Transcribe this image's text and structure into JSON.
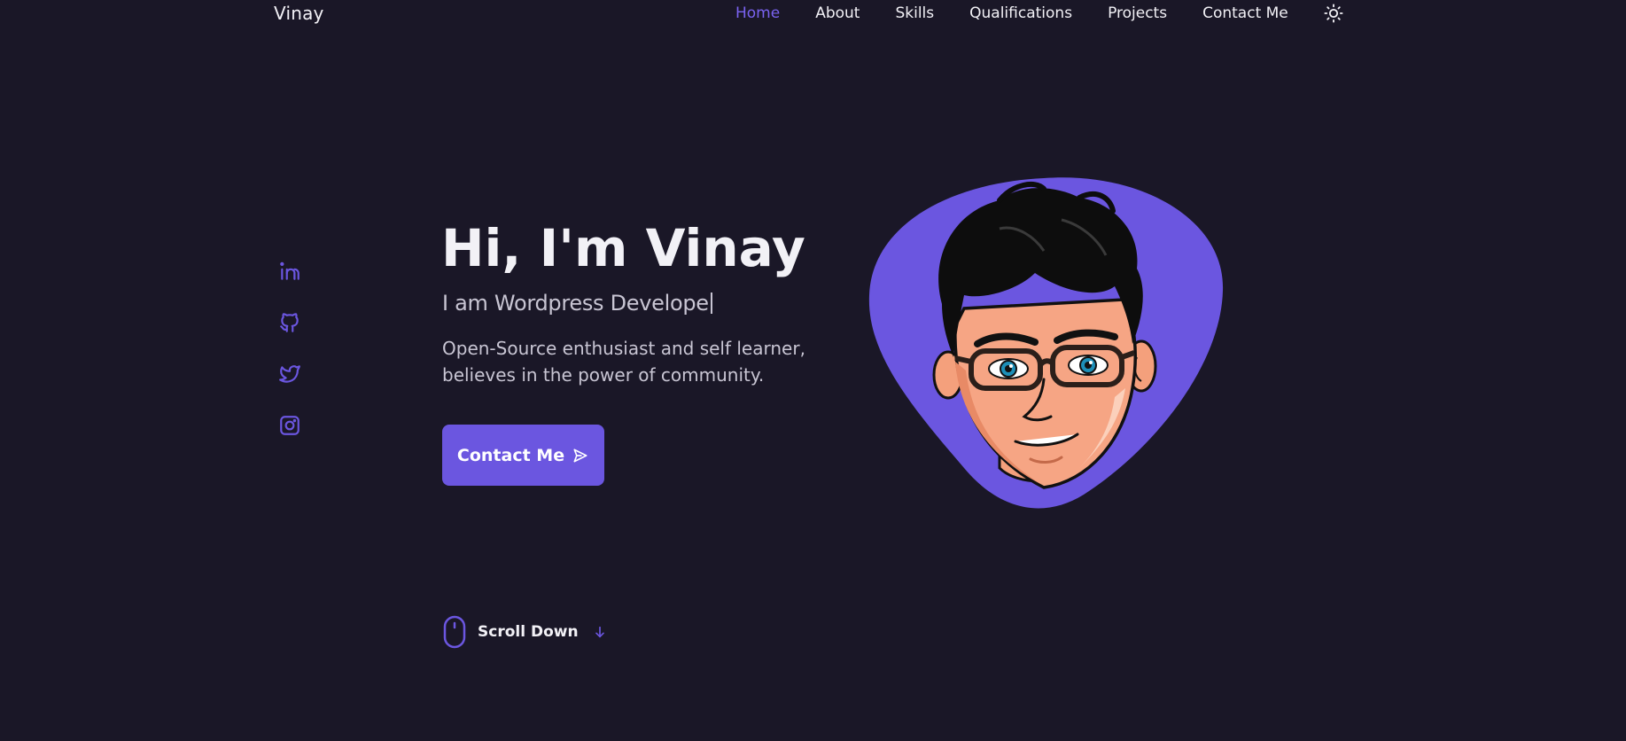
{
  "header": {
    "logo": "Vinay",
    "nav": [
      {
        "label": "Home",
        "active": true
      },
      {
        "label": "About",
        "active": false
      },
      {
        "label": "Skills",
        "active": false
      },
      {
        "label": "Qualifications",
        "active": false
      },
      {
        "label": "Projects",
        "active": false
      },
      {
        "label": "Contact Me",
        "active": false
      }
    ],
    "theme_icon": "sun-icon"
  },
  "social": [
    {
      "icon": "linkedin-icon"
    },
    {
      "icon": "github-icon"
    },
    {
      "icon": "twitter-icon"
    },
    {
      "icon": "instagram-icon"
    }
  ],
  "hero": {
    "title": "Hi, I'm Vinay",
    "subtitle": "I am Wordpress Develope",
    "description": "Open-Source enthusiast and self learner, believes in the power of community.",
    "button_label": "Contact Me",
    "button_icon": "send-icon",
    "avatar_icon": "cartoon-avatar"
  },
  "scroll": {
    "label": "Scroll Down",
    "mouse_icon": "mouse-icon",
    "arrow_icon": "arrow-down-icon"
  },
  "colors": {
    "background": "#1a1727",
    "accent": "#6b56e0",
    "text": "#f2f1f6",
    "muted_text": "#c8c5d3"
  }
}
